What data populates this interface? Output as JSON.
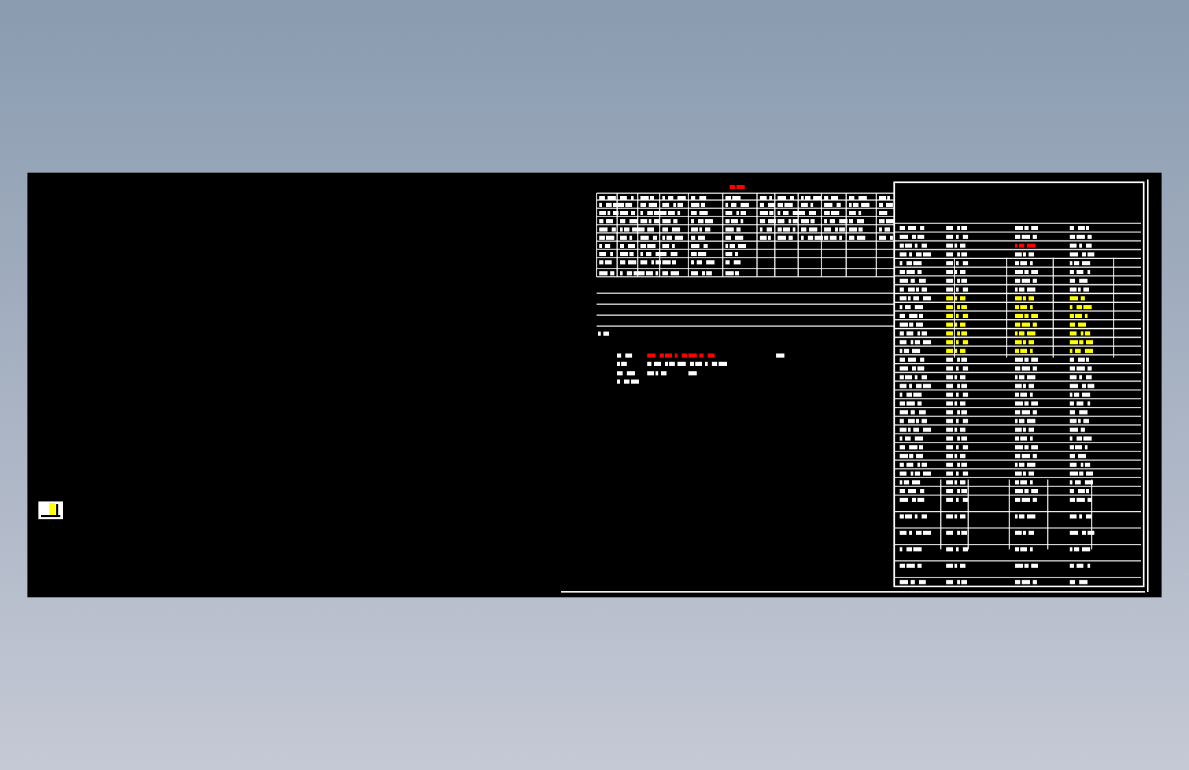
{
  "viewer": {
    "kind": "cad-sheet"
  }
}
